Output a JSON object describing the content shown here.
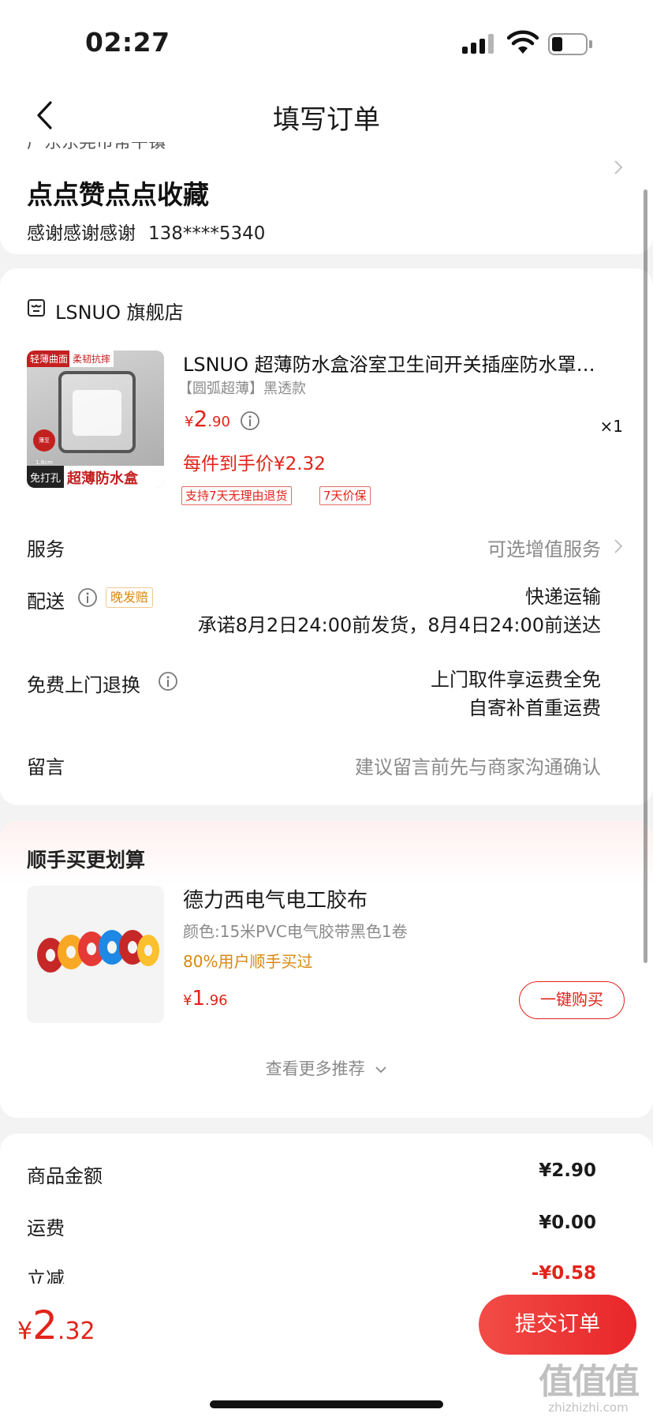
{
  "status_bar": {
    "time": "02:27"
  },
  "nav": {
    "title": "填写订单"
  },
  "address": {
    "cut_text": "广东东莞市常平镇",
    "name": "点点赞点点收藏",
    "recipient": "感谢感谢感谢",
    "phone": "138****5340"
  },
  "store": {
    "name": "LSNUO 旗舰店",
    "product": {
      "title": "LSNUO 超薄防水盒浴室卫生间开关插座防水罩…",
      "spec": "【圆弧超薄】黑透款",
      "price": {
        "currency": "¥",
        "int": "2",
        "dec": ".90"
      },
      "quantity": "×1",
      "final_price": "每件到手价¥2.32",
      "tags": [
        "支持7天无理由退货",
        "7天价保"
      ],
      "image_text": {
        "tag1": "轻薄曲面",
        "tag2": "柔韧抗摔",
        "badge": "薄至1.8cm",
        "bottom_left": "免打孔",
        "bottom_right": "超薄防水盒"
      }
    },
    "rows": {
      "service_label": "服务",
      "service_value": "可选增值服务",
      "delivery_label": "配送",
      "delivery_badge": "晚发赔",
      "delivery_method": "快递运输",
      "delivery_promise": "承诺8月2日24:00前发货，8月4日24:00前送达",
      "return_label": "免费上门退换",
      "return_line1": "上门取件享运费全免",
      "return_line2": "自寄补首重运费",
      "message_label": "留言",
      "message_placeholder": "建议留言前先与商家沟通确认"
    }
  },
  "recommend": {
    "title": "顺手买更划算",
    "item": {
      "name": "德力西电气电工胶布",
      "spec": "颜色:15米PVC电气胶带黑色1卷",
      "bought": "80%用户顺手买过",
      "price": {
        "currency": "¥",
        "int": "1",
        "dec": ".96"
      },
      "button": "一键购买"
    },
    "more": "查看更多推荐"
  },
  "summary": {
    "rows": [
      {
        "label": "商品金额",
        "value": "¥2.90"
      },
      {
        "label": "运费",
        "value": "¥0.00"
      },
      {
        "label": "立减",
        "value": "-¥0.58"
      }
    ],
    "discount_color": "#e2231a"
  },
  "bottom": {
    "total": {
      "currency": "¥",
      "int": "2",
      "dec": ".32"
    },
    "submit": "提交订单",
    "watermark_big": "值值值",
    "watermark_small": "zhizhizhi.com"
  },
  "colors": {
    "accent": "#e2231a",
    "grey_text": "#8a8a8a",
    "orange": "#d8890e"
  },
  "icons": [
    "back-icon",
    "signal-icon",
    "wifi-icon",
    "battery-icon",
    "store-icon",
    "info-icon",
    "chevron-right-icon",
    "chevron-down-icon"
  ]
}
